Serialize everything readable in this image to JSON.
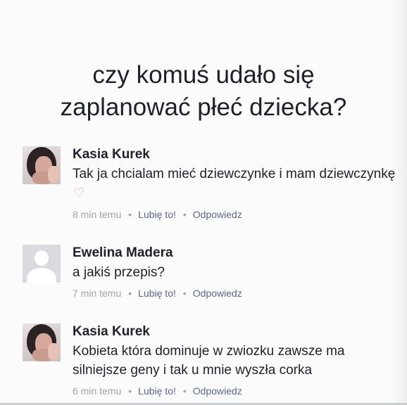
{
  "post": {
    "title_line1": "czy komuś udało się",
    "title_line2": "zaplanować płeć dziecka?"
  },
  "comments": [
    {
      "author": "Kasia Kurek",
      "text": "Tak ja chcialam mieć dziewczynke i mam dziewczynkę",
      "emoji": "♡",
      "time": "8 min temu",
      "like_label": "Lubię to!",
      "reply_label": "Odpowiedz",
      "avatar": "profile-photo"
    },
    {
      "author": "Ewelina Madera",
      "text": "a jakiś przepis?",
      "time": "7 min temu",
      "like_label": "Lubię to!",
      "reply_label": "Odpowiedz",
      "avatar": "default-silhouette"
    },
    {
      "author": "Kasia Kurek",
      "text": "Kobieta która dominuje w zwiozku zawsze ma silniejsze geny i tak u mnie wyszła corka",
      "time": "6 min temu",
      "like_label": "Lubię to!",
      "reply_label": "Odpowiedz",
      "avatar": "profile-photo"
    }
  ],
  "separator": "•",
  "colors": {
    "text": "#1d2129",
    "meta": "#90949c",
    "link": "#5b6a8c",
    "heart": "#e8a0a6"
  }
}
